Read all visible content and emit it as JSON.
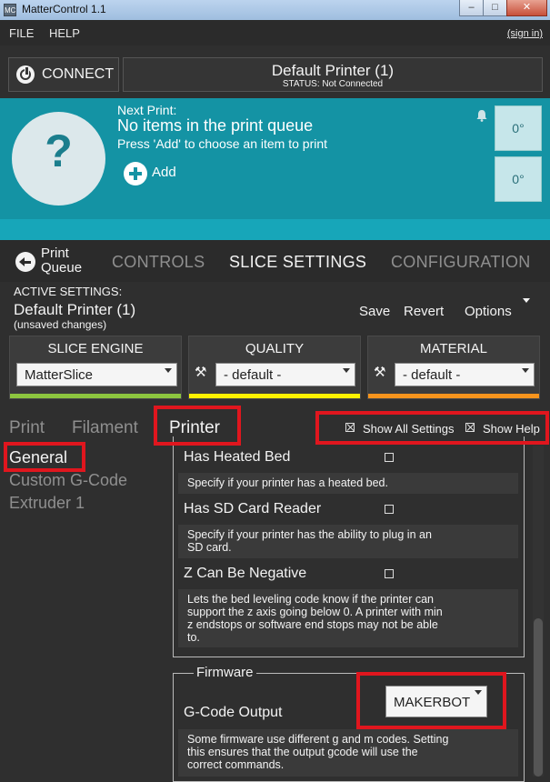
{
  "window": {
    "title": "MatterControl 1.1",
    "app_icon": "MC",
    "minimize": "–",
    "maximize": "□",
    "close": "✕"
  },
  "menu": {
    "file": "FILE",
    "help": "HELP",
    "sign_in": "(sign in)"
  },
  "connect": {
    "label": "CONNECT"
  },
  "printer": {
    "name": "Default Printer (1)",
    "status": "STATUS: Not Connected"
  },
  "queue": {
    "thumbnail_glyph": "?",
    "next_print_label": "Next Print:",
    "title": "No items in the print queue",
    "subtitle": "Press 'Add' to choose an item to print",
    "add_label": "Add",
    "temps": [
      "0°",
      "0°"
    ]
  },
  "tabs": {
    "print_queue_line1": "Print",
    "print_queue_line2": "Queue",
    "controls": "CONTROLS",
    "slice_settings": "SLICE SETTINGS",
    "configuration": "CONFIGURATION"
  },
  "active_settings": {
    "label": "ACTIVE SETTINGS:",
    "name": "Default Printer (1)",
    "unsaved": "(unsaved changes)",
    "save": "Save",
    "revert": "Revert",
    "options": "Options"
  },
  "cards": {
    "slice_engine": {
      "title": "SLICE ENGINE",
      "value": "MatterSlice",
      "color": "#8dc63f"
    },
    "quality": {
      "title": "QUALITY",
      "value": "- default -",
      "color": "#fff200"
    },
    "material": {
      "title": "MATERIAL",
      "value": "- default -",
      "color": "#f7941d"
    }
  },
  "subtabs": {
    "print": "Print",
    "filament": "Filament",
    "printer": "Printer"
  },
  "toggles": {
    "show_all_settings": "Show All Settings",
    "show_help": "Show Help"
  },
  "nav": {
    "general": "General",
    "custom_gcode": "Custom G-Code",
    "extruder": "Extruder 1"
  },
  "settings": {
    "heated_bed": {
      "label": "Has Heated Bed",
      "help": "Specify if your printer has a heated bed."
    },
    "sd_card": {
      "label": "Has SD Card Reader",
      "help_1": "Specify if your printer has the ability to plug in an",
      "help_2": "SD card."
    },
    "z_negative": {
      "label": "Z Can Be Negative",
      "help_1": "Lets the bed leveling code know if the printer can",
      "help_2": "support the z axis going below 0. A printer with min",
      "help_3": "z endstops or software end stops may not be able",
      "help_4": "to."
    },
    "firmware": {
      "legend": "Firmware",
      "gcode_output_label": "G-Code Output",
      "gcode_output_value": "MAKERBOT",
      "help_1": "Some firmware use different g and m codes. Setting",
      "help_2": "this ensures that the output gcode will use the",
      "help_3": "correct commands."
    }
  },
  "colors": {
    "teal": "#1493a4",
    "highlight_red": "#e0161e"
  }
}
